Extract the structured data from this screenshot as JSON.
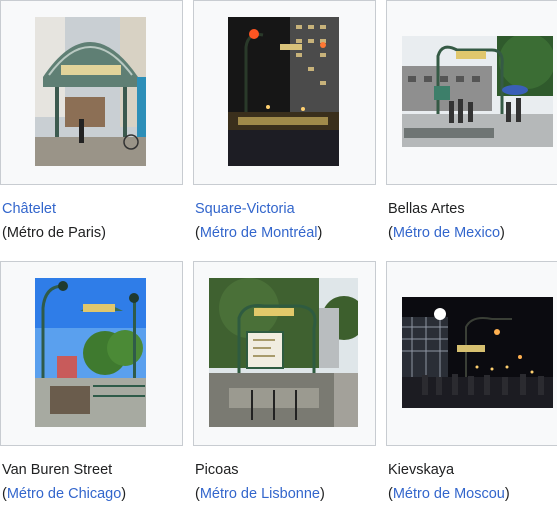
{
  "gallery": {
    "items": [
      {
        "title": "Châtelet",
        "title_link": true,
        "paren_open": "(",
        "network": "Métro de Paris",
        "network_link": false,
        "paren_close": ")",
        "image": "metro-entrance-paris"
      },
      {
        "title": "Square-Victoria",
        "title_link": true,
        "paren_open": "(",
        "network": "Métro de Montréal",
        "network_link": true,
        "paren_close": ")",
        "image": "metro-entrance-montreal"
      },
      {
        "title": "Bellas Artes",
        "title_link": false,
        "paren_open": "(",
        "network": "Métro de Mexico",
        "network_link": true,
        "paren_close": ")",
        "image": "metro-entrance-mexico"
      },
      {
        "title": "Van Buren Street",
        "title_link": false,
        "paren_open": "(",
        "network": "Métro de Chicago",
        "network_link": true,
        "paren_close": ")",
        "image": "metro-entrance-chicago"
      },
      {
        "title": "Picoas",
        "title_link": false,
        "paren_open": "(",
        "network": "Métro de Lisbonne",
        "network_link": true,
        "paren_close": ")",
        "image": "metro-entrance-lisbon"
      },
      {
        "title": "Kievskaya",
        "title_link": false,
        "paren_open": "(",
        "network": "Métro de Moscou",
        "network_link": true,
        "paren_close": ")",
        "image": "metro-entrance-moscow"
      }
    ]
  },
  "colors": {
    "link": "#3366cc",
    "text": "#202122",
    "frame_bg": "#f8f9fa",
    "frame_border": "#c8ccd1"
  }
}
